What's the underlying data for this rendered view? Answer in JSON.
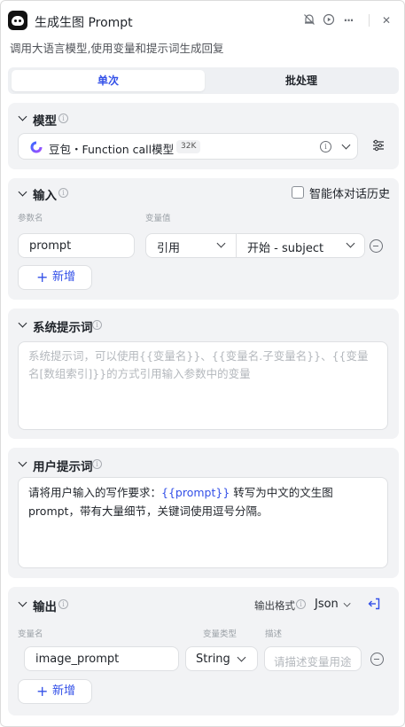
{
  "header": {
    "title": "生成生图 Prompt",
    "subtitle": "调用大语言模型,使用变量和提示词生成回复",
    "icons": [
      "debug-off-icon",
      "run-icon",
      "more-icon",
      "close-icon"
    ],
    "more_glyph": "···",
    "close_glyph": "✕"
  },
  "tabs": {
    "single": "单次",
    "batch": "批处理"
  },
  "model_section": {
    "title": "模型",
    "model_name": "豆包・Function call模型",
    "badge": "32K"
  },
  "input_section": {
    "title": "输入",
    "history_label": "智能体对话历史",
    "history_checked": false,
    "param_col": "参数名",
    "value_col": "变量值",
    "row": {
      "param": "prompt",
      "ref_type": "引用",
      "ref_value": "开始 - subject"
    },
    "add_label": "新增"
  },
  "system_prompt": {
    "title": "系统提示词",
    "placeholder": "系统提示词，可以使用{{变量名}}、{{变量名.子变量名}}、{{变量名[数组索引]}}的方式引用输入参数中的变量"
  },
  "user_prompt": {
    "title": "用户提示词",
    "text_before": "请将用户输入的写作要求：",
    "variable": "{{prompt}}",
    "text_after": " 转写为中文的文生图 prompt，带有大量细节，关键词使用逗号分隔。"
  },
  "output_section": {
    "title": "输出",
    "format_label": "输出格式",
    "format_value": "Json",
    "name_col": "变量名",
    "type_col": "变量类型",
    "desc_col": "描述",
    "row": {
      "name": "image_prompt",
      "type": "String",
      "desc_placeholder": "请描述变量用途"
    },
    "add_label": "新增"
  },
  "colors": {
    "accent": "#3350e8",
    "card_bg": "#f2f3f5"
  }
}
